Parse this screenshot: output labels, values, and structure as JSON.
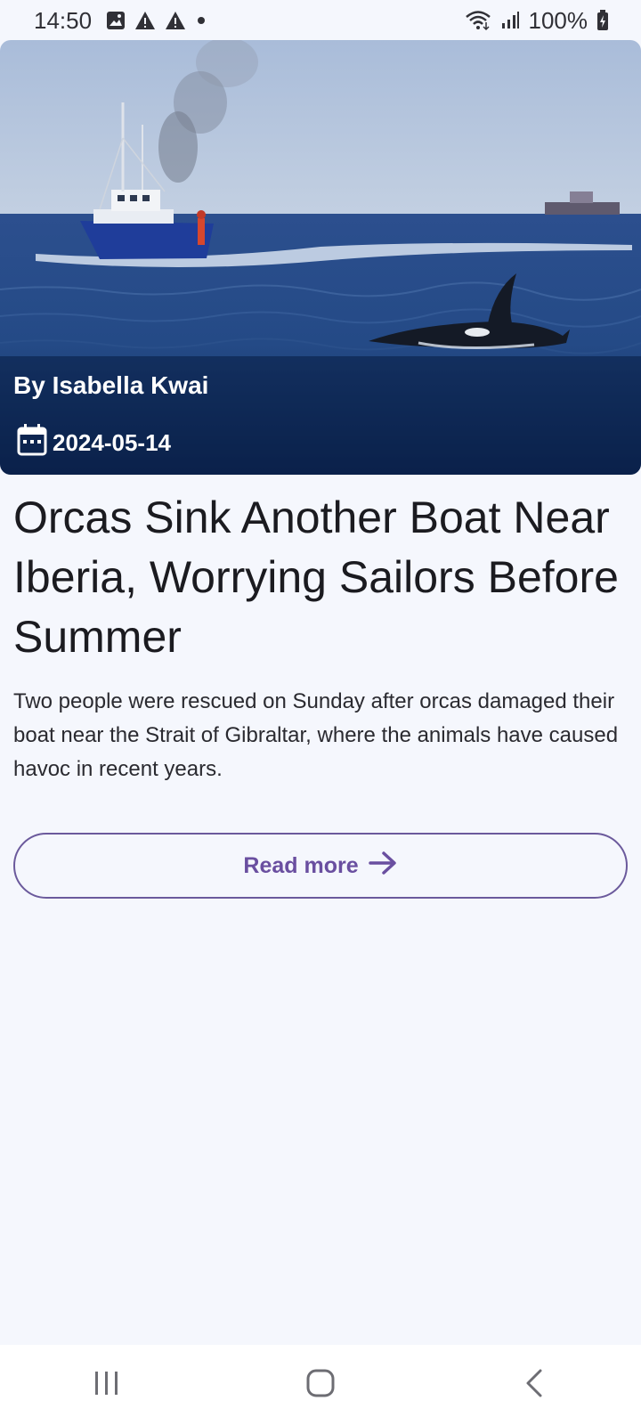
{
  "status_bar": {
    "time": "14:50",
    "battery": "100%",
    "icons": [
      "image-icon",
      "warning-icon",
      "warning-icon",
      "dot-icon",
      "wifi-icon",
      "signal-icon",
      "battery-charging-icon"
    ]
  },
  "article": {
    "image_icon": "orca-boat-photo",
    "author": "By Isabella Kwai",
    "date": "2024-05-14",
    "date_icon": "calendar-icon",
    "headline": "Orcas Sink Another Boat Near Iberia, Worrying Sailors Before Summer",
    "summary": "Two people were rescued on Sunday after orcas damaged their boat near the Strait of Gibraltar, where the animals have caused havoc in recent years.",
    "read_more_label": "Read more",
    "read_more_icon": "arrow-right-icon"
  },
  "nav_bar": {
    "buttons": [
      "recent-apps-icon",
      "home-icon",
      "back-icon"
    ]
  },
  "colors": {
    "background": "#f5f7fd",
    "accent": "#6a4fa0",
    "text": "#1b1b20"
  }
}
